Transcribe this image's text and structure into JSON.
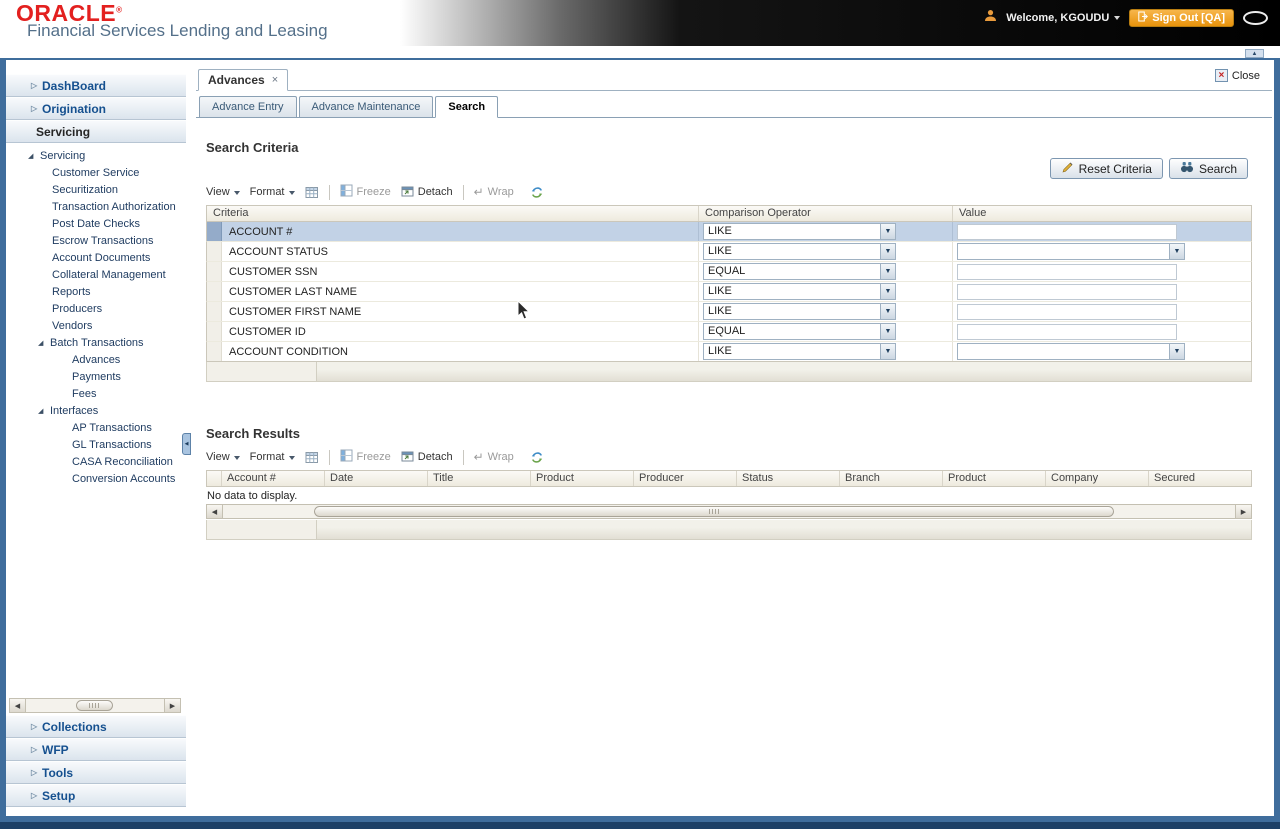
{
  "header": {
    "logo": "ORACLE",
    "registered": "®",
    "app_title": "Financial Services Lending and Leasing",
    "welcome_label": "Welcome, KGOUDU",
    "sign_out_label": "Sign Out [QA]"
  },
  "colors": {
    "oracle_red": "#e3201f",
    "signout_orange": "#ee9d18",
    "frame_blue": "#3f6d9c",
    "selected_row": "#c2d2e6",
    "section_header_text": "#15508f"
  },
  "icons": {
    "accordion_arrow": "▷",
    "tree_expanded": "◢",
    "dropdown": "▼",
    "collapse_up": "▲",
    "scroll_left": "◀",
    "scroll_right": "▶",
    "splitter_left": "◀",
    "wrap": "↵",
    "close": "×"
  },
  "sidebar": {
    "sections": [
      {
        "label": "DashBoard"
      },
      {
        "label": "Origination"
      },
      {
        "label": "Servicing"
      },
      {
        "label": "Collections"
      },
      {
        "label": "WFP"
      },
      {
        "label": "Tools"
      },
      {
        "label": "Setup"
      }
    ],
    "tree": {
      "root_label": "Servicing",
      "servicing_children": [
        "Customer Service",
        "Securitization",
        "Transaction Authorization",
        "Post Date Checks",
        "Escrow Transactions",
        "Account Documents",
        "Collateral Management",
        "Reports",
        "Producers",
        "Vendors"
      ],
      "batch_label": "Batch Transactions",
      "batch_children": [
        "Advances",
        "Payments",
        "Fees"
      ],
      "interfaces_label": "Interfaces",
      "interfaces_children": [
        "AP Transactions",
        "GL Transactions",
        "CASA Reconciliation",
        "Conversion Accounts"
      ]
    }
  },
  "window": {
    "tab_label": "Advances",
    "close_label": "Close",
    "subtabs": [
      "Advance Entry",
      "Advance Maintenance",
      "Search"
    ],
    "active_subtab": "Search"
  },
  "toolbar": {
    "view": "View",
    "format": "Format",
    "freeze": "Freeze",
    "detach": "Detach",
    "wrap": "Wrap"
  },
  "search_criteria": {
    "title": "Search Criteria",
    "reset_button": "Reset Criteria",
    "search_button": "Search",
    "columns": [
      "Criteria",
      "Comparison Operator",
      "Value"
    ],
    "rows": [
      {
        "criteria": "ACCOUNT #",
        "operator": "LIKE",
        "value_kind": "text",
        "value": "",
        "selected": true
      },
      {
        "criteria": "ACCOUNT STATUS",
        "operator": "LIKE",
        "value_kind": "select",
        "value": ""
      },
      {
        "criteria": "CUSTOMER SSN",
        "operator": "EQUAL",
        "value_kind": "text",
        "value": ""
      },
      {
        "criteria": "CUSTOMER LAST NAME",
        "operator": "LIKE",
        "value_kind": "text",
        "value": ""
      },
      {
        "criteria": "CUSTOMER FIRST NAME",
        "operator": "LIKE",
        "value_kind": "text",
        "value": ""
      },
      {
        "criteria": "CUSTOMER ID",
        "operator": "EQUAL",
        "value_kind": "text",
        "value": ""
      },
      {
        "criteria": "ACCOUNT CONDITION",
        "operator": "LIKE",
        "value_kind": "select",
        "value": ""
      }
    ]
  },
  "search_results": {
    "title": "Search Results",
    "columns": [
      "Account #",
      "Date",
      "Title",
      "Product",
      "Producer",
      "Status",
      "Branch",
      "Product",
      "Company",
      "Secured"
    ],
    "empty_message": "No data to display."
  }
}
